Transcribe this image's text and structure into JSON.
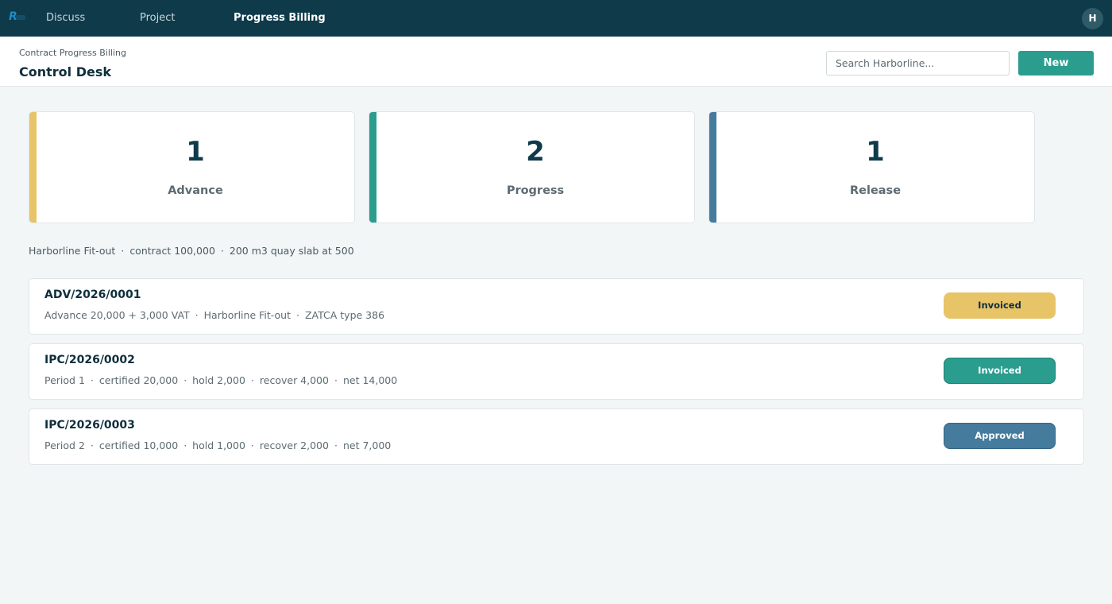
{
  "colors": {
    "topbar": "#0e3a4a",
    "accent_advance": "#e8c468",
    "accent_progress": "#2a9d8f",
    "accent_release": "#457b9d",
    "primary_button": "#2a9d8f"
  },
  "topbar": {
    "logo_icon": "app-logo",
    "nav": [
      {
        "label": "Discuss",
        "active": false
      },
      {
        "label": "Project",
        "active": false
      },
      {
        "label": "Progress Billing",
        "active": true
      }
    ],
    "avatar_initial": "H"
  },
  "header": {
    "breadcrumb": "Contract Progress Billing",
    "title": "Control Desk",
    "search_placeholder": "Search Harborline...",
    "new_label": "New"
  },
  "stats": [
    {
      "value": "1",
      "label": "Advance",
      "color": "#e8c468"
    },
    {
      "value": "2",
      "label": "Progress",
      "color": "#2a9d8f"
    },
    {
      "value": "1",
      "label": "Release",
      "color": "#457b9d"
    }
  ],
  "context": {
    "parts": [
      "Harborline Fit-out",
      "contract 100,000",
      "200 m3 quay slab at 500"
    ]
  },
  "documents": [
    {
      "id": "ADV/2026/0001",
      "details": [
        "Advance 20,000 + 3,000 VAT",
        "Harborline Fit-out",
        "ZATCA type 386"
      ],
      "status": "Invoiced",
      "status_color": "#e8c468"
    },
    {
      "id": "IPC/2026/0002",
      "details": [
        "Period 1",
        "certified 20,000",
        "hold 2,000",
        "recover 4,000",
        "net 14,000"
      ],
      "status": "Invoiced",
      "status_color": "#2a9d8f"
    },
    {
      "id": "IPC/2026/0003",
      "details": [
        "Period 2",
        "certified 10,000",
        "hold 1,000",
        "recover 2,000",
        "net 7,000"
      ],
      "status": "Approved",
      "status_color": "#457b9d"
    }
  ]
}
